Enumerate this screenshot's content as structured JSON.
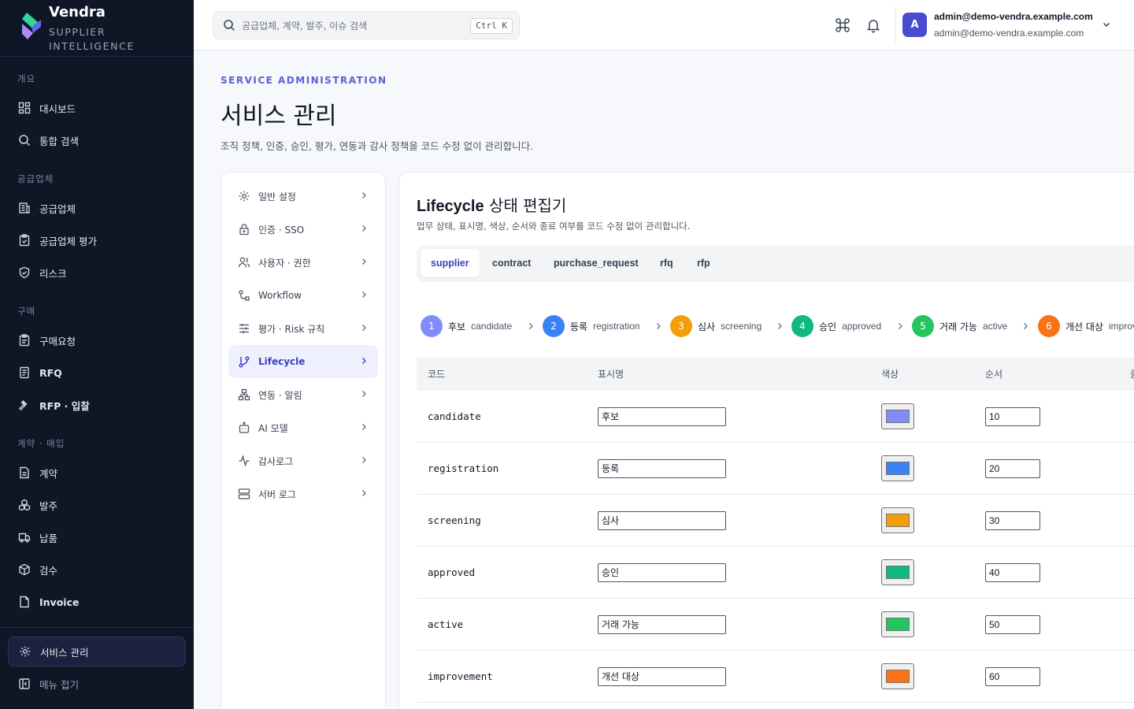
{
  "brand": {
    "name": "Vendra",
    "subtitle": "SUPPLIER INTELLIGENCE"
  },
  "sidebar": {
    "sections": [
      "개요",
      "공급업체",
      "구매",
      "계약 · 매입"
    ],
    "items": [
      {
        "label": "대시보드",
        "icon": "grid-icon"
      },
      {
        "label": "통합 검색",
        "icon": "search-icon"
      },
      {
        "label": "공급업체",
        "icon": "building-icon"
      },
      {
        "label": "공급업체 평가",
        "icon": "clipboard-check-icon"
      },
      {
        "label": "리스크",
        "icon": "shield-icon"
      },
      {
        "label": "구매요청",
        "icon": "clipboard-icon"
      },
      {
        "label": "RFQ",
        "icon": "document-icon"
      },
      {
        "label": "RFP · 입찰",
        "icon": "gavel-icon"
      },
      {
        "label": "계약",
        "icon": "file-icon"
      },
      {
        "label": "발주",
        "icon": "boxes-icon"
      },
      {
        "label": "납품",
        "icon": "truck-icon"
      },
      {
        "label": "검수",
        "icon": "package-check-icon"
      },
      {
        "label": "Invoice",
        "icon": "receipt-icon"
      }
    ],
    "admin": "서비스 관리",
    "collapse": "메뉴 접기"
  },
  "topbar": {
    "search_placeholder": "공급업체, 계약, 발주, 이슈 검색",
    "shortcut": "Ctrl K",
    "avatar_initial": "A",
    "user_name": "admin@demo-vendra.example.com",
    "user_email": "admin@demo-vendra.example.com"
  },
  "header": {
    "eyebrow": "SERVICE ADMINISTRATION",
    "title": "서비스 관리",
    "description": "조직 정책, 인증, 승인, 평가, 연동과 감사 정책을 코드 수정 없이 관리합니다."
  },
  "settings_nav": [
    {
      "label": "일반 설정",
      "icon": "gear-icon"
    },
    {
      "label": "인증 · SSO",
      "icon": "lock-icon"
    },
    {
      "label": "사용자 · 권한",
      "icon": "users-icon"
    },
    {
      "label": "Workflow",
      "icon": "workflow-icon"
    },
    {
      "label": "평가 · Risk 규칙",
      "icon": "sliders-icon"
    },
    {
      "label": "Lifecycle",
      "icon": "git-branch-icon",
      "active": true
    },
    {
      "label": "연동 · 알림",
      "icon": "network-icon"
    },
    {
      "label": "AI 모델",
      "icon": "bot-icon"
    },
    {
      "label": "감사로그",
      "icon": "activity-icon"
    },
    {
      "label": "서버 로그",
      "icon": "server-icon"
    }
  ],
  "editor": {
    "title_en": "Lifecycle",
    "title_ko": "상태 편집기",
    "description": "업무 상태, 표시명, 색상, 순서와 종료 여부를 코드 수정 없이 관리합니다.",
    "tabs": [
      "supplier",
      "contract",
      "purchase_request",
      "rfq",
      "rfp"
    ],
    "active_tab": "supplier",
    "steps": [
      {
        "num": "1",
        "ko": "후보",
        "en": "candidate",
        "color": "#818cf8"
      },
      {
        "num": "2",
        "ko": "등록",
        "en": "registration",
        "color": "#3b82f6"
      },
      {
        "num": "3",
        "ko": "심사",
        "en": "screening",
        "color": "#f59e0b"
      },
      {
        "num": "4",
        "ko": "승인",
        "en": "approved",
        "color": "#10b981"
      },
      {
        "num": "5",
        "ko": "거래 가능",
        "en": "active",
        "color": "#22c55e"
      },
      {
        "num": "6",
        "ko": "개선 대상",
        "en": "improvement",
        "color": "#f97316"
      }
    ],
    "columns": [
      "코드",
      "표시명",
      "색상",
      "순서",
      "종료"
    ],
    "rows": [
      {
        "code": "candidate",
        "name": "후보",
        "color": "#818cf8",
        "order": "10"
      },
      {
        "code": "registration",
        "name": "등록",
        "color": "#3b82f6",
        "order": "20"
      },
      {
        "code": "screening",
        "name": "심사",
        "color": "#f59e0b",
        "order": "30"
      },
      {
        "code": "approved",
        "name": "승인",
        "color": "#10b981",
        "order": "40"
      },
      {
        "code": "active",
        "name": "거래 가능",
        "color": "#22c55e",
        "order": "50"
      },
      {
        "code": "improvement",
        "name": "개선 대상",
        "color": "#f97316",
        "order": "60"
      }
    ]
  },
  "colors": {
    "accent": "#3b3fc4",
    "sidebar_bg": "#0f1626"
  }
}
